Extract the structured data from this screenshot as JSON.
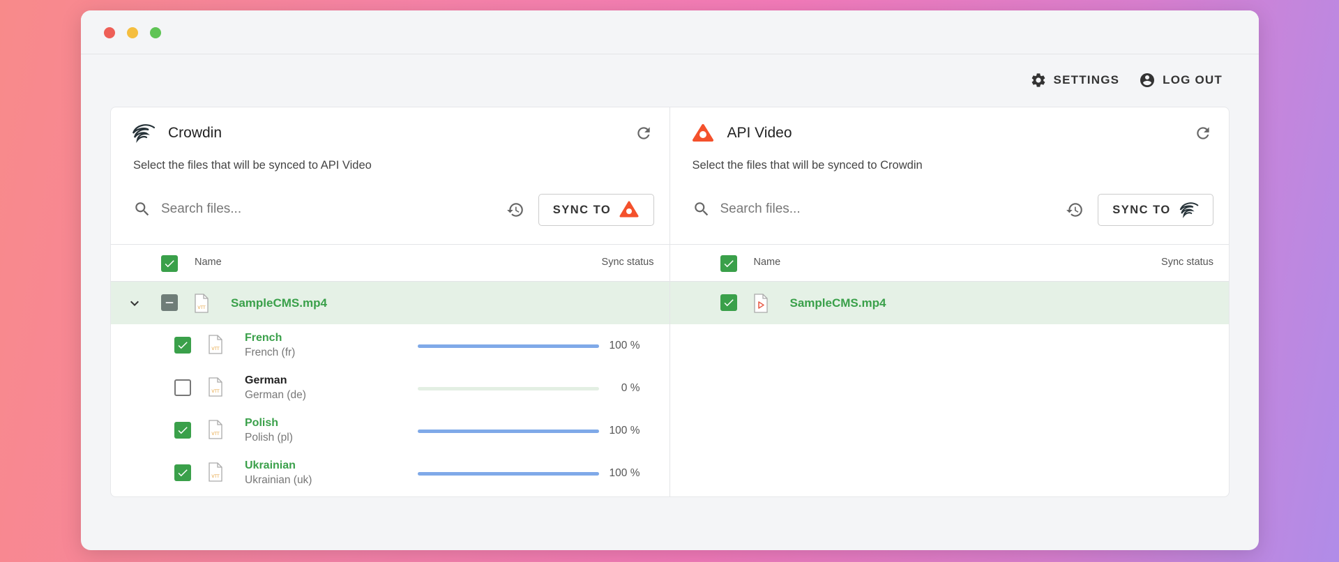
{
  "nav": {
    "settings_label": "SETTINGS",
    "logout_label": "LOG OUT"
  },
  "left": {
    "title": "Crowdin",
    "subtitle": "Select the files that will be synced to API Video",
    "search_placeholder": "Search files...",
    "sync_label": "SYNC TO",
    "col_name": "Name",
    "col_status": "Sync status",
    "file": {
      "name": "SampleCMS.mp4",
      "state": "mixed"
    },
    "languages": [
      {
        "name": "French",
        "detail": "French  (fr)",
        "checked": true,
        "progress": 1.0,
        "pct": "100 %"
      },
      {
        "name": "German",
        "detail": "German  (de)",
        "checked": false,
        "progress": 0.0,
        "pct": "0 %"
      },
      {
        "name": "Polish",
        "detail": "Polish  (pl)",
        "checked": true,
        "progress": 1.0,
        "pct": "100 %"
      },
      {
        "name": "Ukrainian",
        "detail": "Ukrainian  (uk)",
        "checked": true,
        "progress": 1.0,
        "pct": "100 %"
      }
    ]
  },
  "right": {
    "title": "API Video",
    "subtitle": "Select the files that will be synced to Crowdin",
    "search_placeholder": "Search files...",
    "sync_label": "SYNC TO",
    "col_name": "Name",
    "col_status": "Sync status",
    "file": {
      "name": "SampleCMS.mp4",
      "checked": true
    }
  },
  "colors": {
    "accent_green": "#3aa04a",
    "selected_row": "#e5f1e6",
    "progress_blue": "#7fa9e8",
    "apivideo_orange": "#f4512c"
  },
  "icons": [
    "gear-icon",
    "account-circle-icon",
    "crowdin-logo-icon",
    "apivideo-logo-icon",
    "refresh-icon",
    "search-icon",
    "history-icon",
    "chevron-down-icon",
    "vtt-file-icon",
    "video-file-icon",
    "check-icon"
  ]
}
